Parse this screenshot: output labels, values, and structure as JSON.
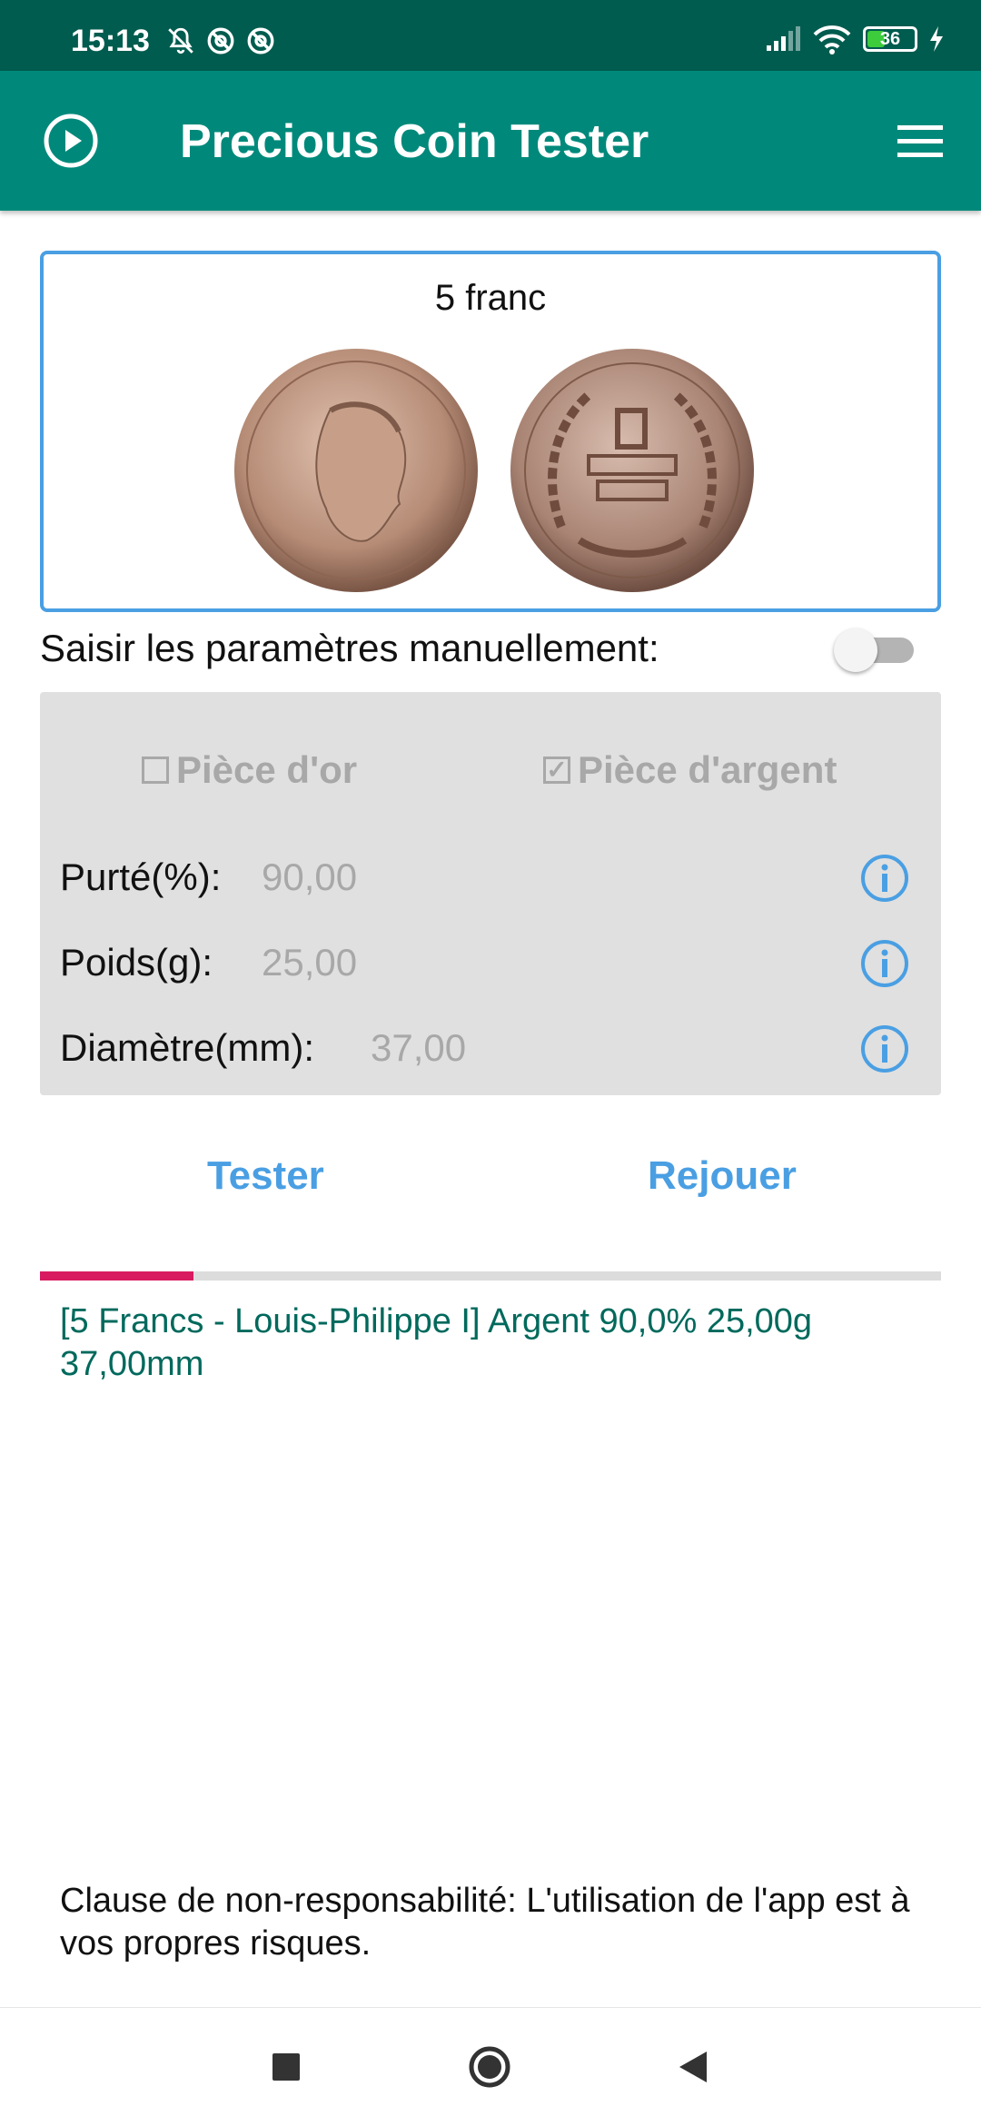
{
  "status_bar": {
    "time": "15:13",
    "icons": [
      "bell-off-icon",
      "at-sign-icon",
      "at-sign-icon",
      "signal-icon",
      "wifi-icon",
      "battery-icon",
      "charging-icon"
    ],
    "battery_level": "36",
    "battery_fraction": 0.36
  },
  "app_bar": {
    "title": "Precious Coin Tester",
    "left_icon": "play-circle-icon",
    "right_icon": "menu-icon",
    "color": "#00897b",
    "status_color": "#005c4f"
  },
  "coin": {
    "name": "5 franc",
    "images": [
      "coin-obverse",
      "coin-reverse"
    ]
  },
  "manual_toggle": {
    "label": "Saisir les paramètres manuellement:",
    "enabled": false
  },
  "params": {
    "gold_checkbox": {
      "label": "Pièce d'or",
      "checked": false,
      "mark": ""
    },
    "silver_checkbox": {
      "label": "Pièce d'argent",
      "checked": true,
      "mark": "✓"
    },
    "rows": [
      {
        "label": "Purté(%):",
        "value": "90,00"
      },
      {
        "label": "Poids(g):",
        "value": "25,00"
      },
      {
        "label": "Diamètre(mm):",
        "value": "37,00"
      }
    ]
  },
  "actions": {
    "test": "Tester",
    "replay": "Rejouer"
  },
  "progress": {
    "fraction": 0.17,
    "color": "#d81b60"
  },
  "result_text": "[5 Francs - Louis-Philippe I] Argent 90,0% 25,00g 37,00mm",
  "disclaimer": "Clause de non-responsabilité: L'utilisation de l'app est à vos propres risques.",
  "nav": [
    "recents-icon",
    "home-icon",
    "back-icon"
  ],
  "colors": {
    "accent": "#4a9fe3",
    "result": "#00695c"
  }
}
